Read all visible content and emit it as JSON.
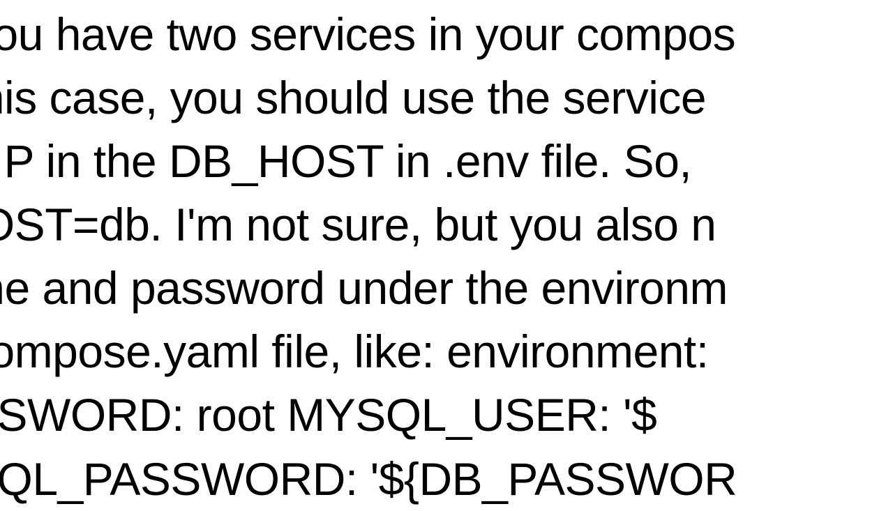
{
  "document": {
    "line1": "You have two services in your compos",
    "line2": "this case, you should use the service",
    "line3": "f IP in the DB_HOST in .env file. So,",
    "line4": "IOST=db. I'm not sure, but you also n",
    "line5": "me and password under the environm",
    "line6": "compose.yaml file, like: environment:",
    "line7": "SSWORD: root      MYSQL_USER: '$",
    "line8": "SQL_PASSWORD: '${DB_PASSWOR"
  }
}
